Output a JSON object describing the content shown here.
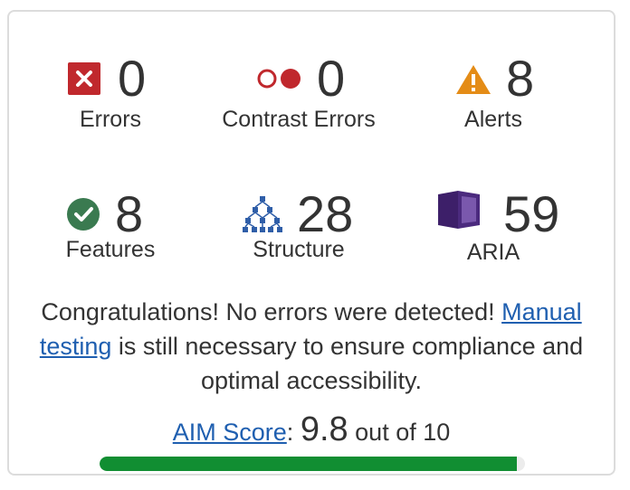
{
  "summary": {
    "errors": {
      "count": "0",
      "label": "Errors",
      "icon": "error-icon",
      "color": "#c0282d"
    },
    "contrast_errors": {
      "count": "0",
      "label": "Contrast Errors",
      "icon": "contrast-error-icon",
      "color": "#c0282d"
    },
    "alerts": {
      "count": "8",
      "label": "Alerts",
      "icon": "alert-icon",
      "color": "#e48c17"
    },
    "features": {
      "count": "8",
      "label": "Features",
      "icon": "feature-check-icon",
      "color": "#3a7a50"
    },
    "structure": {
      "count": "28",
      "label": "Structure",
      "icon": "structure-icon",
      "color": "#2f5ea8"
    },
    "aria": {
      "count": "59",
      "label": "ARIA",
      "icon": "aria-icon",
      "color": "#4b2a7e"
    }
  },
  "message": {
    "text_before": "Congratulations! No errors were detected! ",
    "link_text": "Manual testing",
    "text_after": " is still necessary to ensure compliance and optimal accessibility."
  },
  "score": {
    "link_text": "AIM Score",
    "separator": ":",
    "value": "9.8",
    "suffix": "out of 10",
    "fraction": 0.98,
    "bar_color": "#118e32"
  }
}
